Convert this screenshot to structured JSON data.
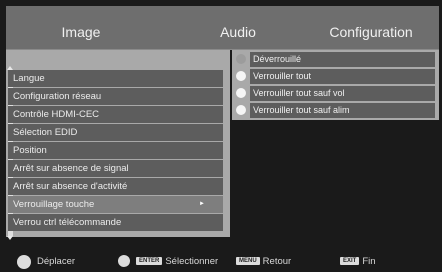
{
  "tabs": [
    "Image",
    "Audio",
    "Configuration"
  ],
  "menu": {
    "items": [
      "Langue",
      "Configuration réseau",
      "Contrôle HDMI-CEC",
      "Sélection EDID",
      "Position",
      "Arrêt sur absence de signal",
      "Arrêt sur absence d'activité",
      "Verrouillage touche",
      "Verrou ctrl télécommande"
    ],
    "selected_index": 7
  },
  "options": {
    "items": [
      "Déverrouillé",
      "Verrouiller tout",
      "Verrouiller tout sauf vol",
      "Verrouiller tout sauf alim"
    ],
    "disabled_index": 0
  },
  "footer": {
    "move_label": "Déplacer",
    "enter_key": "ENTER",
    "select_label": "Sélectionner",
    "menu_key": "MENU",
    "back_label": "Retour",
    "exit_key": "EXIT",
    "end_label": "Fin"
  },
  "icons": [
    "navigation-pad-icon",
    "ok-button-icon",
    "submenu-arrow-icon",
    "scroll-up-icon",
    "scroll-down-icon"
  ],
  "colors": {
    "background": "#1a1a1a",
    "tab_bar": "#6e6e6e",
    "panel": "#a9a9a9",
    "item": "#5d5d5d",
    "selected_item": "#7e7e7e"
  }
}
